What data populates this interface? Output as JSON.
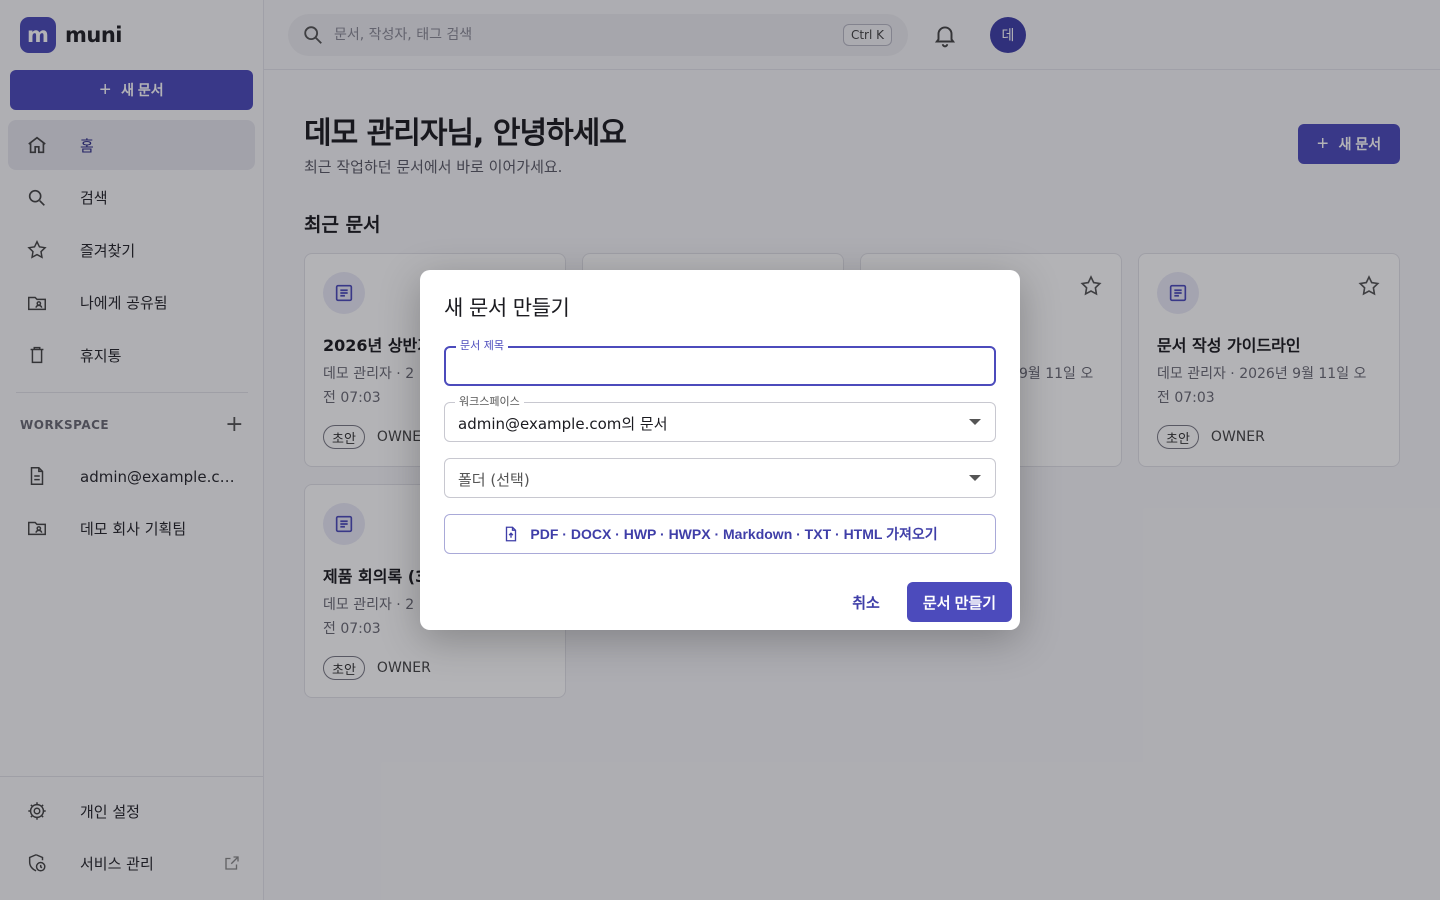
{
  "app": {
    "logo_letter": "m",
    "name": "muni"
  },
  "sidebar": {
    "new_doc_label": "새 문서",
    "nav": [
      {
        "label": "홈",
        "icon": "home-icon"
      },
      {
        "label": "검색",
        "icon": "search-icon"
      },
      {
        "label": "즐겨찾기",
        "icon": "star-icon"
      },
      {
        "label": "나에게 공유됨",
        "icon": "shared-folder-icon"
      },
      {
        "label": "휴지통",
        "icon": "trash-icon"
      }
    ],
    "workspace_heading": "WORKSPACE",
    "workspaces": [
      {
        "label": "admin@example.com의 문서",
        "icon": "document-icon"
      },
      {
        "label": "데모 회사 기획팀",
        "icon": "team-folder-icon"
      }
    ],
    "bottom": [
      {
        "label": "개인 설정",
        "icon": "gear-icon"
      },
      {
        "label": "서비스 관리",
        "icon": "admin-shield-icon"
      }
    ]
  },
  "topbar": {
    "search_placeholder": "문서, 작성자, 태그 검색",
    "shortcut": "Ctrl K",
    "avatar_initial": "데"
  },
  "main": {
    "greeting": "데모 관리자님, 안녕하세요",
    "subtitle": "최근 작업하던 문서에서 바로 이어가세요.",
    "new_doc_label": "새 문서",
    "recent_heading": "최근 문서",
    "cards": [
      {
        "title": "2026년 상반기",
        "meta": "데모 관리자 · 2",
        "meta2": "전 07:03",
        "chip": "초안",
        "role": "OWNE"
      },
      {
        "title": "",
        "meta": "",
        "meta2": "",
        "chip": "",
        "role": ""
      },
      {
        "title": "",
        "meta": "9월 11일 오",
        "meta2": "",
        "chip": "",
        "role": ""
      },
      {
        "title": "문서 작성 가이드라인",
        "meta": "데모 관리자 · 2026년 9월 11일 오",
        "meta2": "전 07:03",
        "chip": "초안",
        "role": "OWNER"
      },
      {
        "title": "제품 회의록 (3",
        "meta": "데모 관리자 · 2",
        "meta2": "전 07:03",
        "chip": "초안",
        "role": "OWNER"
      }
    ]
  },
  "modal": {
    "title": "새 문서 만들기",
    "title_field_label": "문서 제목",
    "title_field_value": "",
    "workspace_label": "워크스페이스",
    "workspace_value": "admin@example.com의 문서",
    "folder_placeholder": "폴더 (선택)",
    "import_label": "PDF · DOCX · HWP · HWPX · Markdown · TXT · HTML 가져오기",
    "cancel_label": "취소",
    "create_label": "문서 만들기"
  },
  "colors": {
    "accent": "#4c4bbc",
    "accent_dark": "#3f3ea8"
  }
}
